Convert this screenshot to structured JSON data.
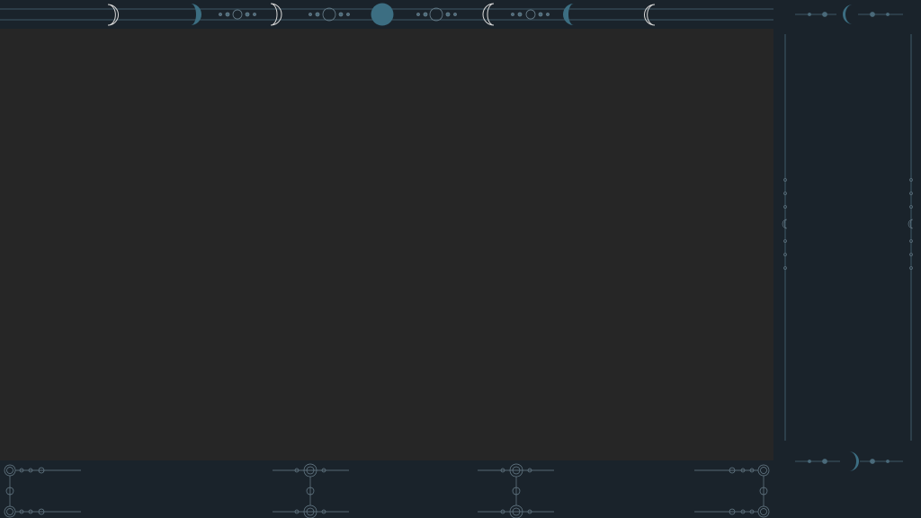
{
  "colors": {
    "background": "#1a232b",
    "content_panel": "#262626",
    "line": "#4a6a7a",
    "accent": "#3c6e82",
    "outline": "#d8d8d8",
    "muted": "#6a7f8c",
    "rose": "#8a6a72"
  },
  "decor": {
    "top_moon_phases": [
      "waxing-crescent-outline",
      "waning-crescent-filled",
      "waxing-gibbous-outline",
      "full-moon",
      "waning-gibbous-outline",
      "waxing-crescent-filled",
      "waning-crescent-outline"
    ],
    "sidebar_ornaments": [
      "crescent-moon-top",
      "crescent-moon-bottom"
    ],
    "bottom_ornaments": [
      "celestial-ornament-left",
      "celestial-ornament-center-left",
      "celestial-ornament-center-right",
      "celestial-ornament-right"
    ]
  }
}
